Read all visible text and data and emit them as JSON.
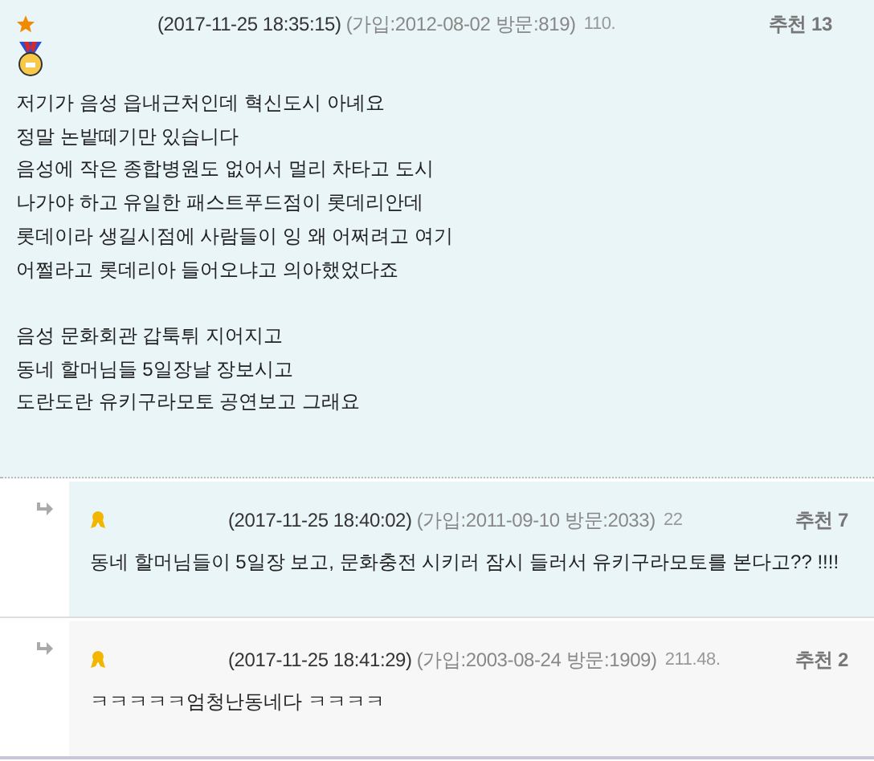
{
  "comments": [
    {
      "kind": "post",
      "date": "(2017-11-25 18:35:15)",
      "member_info": "(가입:2012-08-02 방문:819)",
      "ip": "110.",
      "likes_label": "추천",
      "likes": "13",
      "paragraphs": [
        [
          "저기가 음성 읍내근처인데 혁신도시 아녜요",
          "정말 논밭떼기만 있습니다",
          "음성에 작은 종합병원도 없어서 멀리 차타고 도시",
          "나가야 하고 유일한 패스트푸드점이 롯데리안데",
          "롯데이라 생길시점에 사람들이 잉 왜 어쩌려고 여기",
          "어쩔라고 롯데리아 들어오냐고 의아했었다죠"
        ],
        [
          "음성 문화회관 갑툭튀 지어지고",
          "동네 할머님들 5일장날 장보시고",
          "도란도란 유키구라모토 공연보고 그래요"
        ]
      ]
    },
    {
      "kind": "reply",
      "date": "(2017-11-25 18:40:02)",
      "member_info": "(가입:2011-09-10 방문:2033)",
      "ip": "22",
      "likes_label": "추천",
      "likes": "7",
      "paragraphs": [
        [
          "동네 할머님들이 5일장 보고, 문화충전 시키러 잠시 들러서 유키구라모토를 본다고?? !!!!"
        ]
      ]
    },
    {
      "kind": "reply",
      "date": "(2017-11-25 18:41:29)",
      "member_info": "(가입:2003-08-24 방문:1909)",
      "ip": "211.48.",
      "likes_label": "추천",
      "likes": "2",
      "paragraphs": [
        [
          "ㅋㅋㅋㅋㅋ엄청난동네다 ㅋㅋㅋㅋ"
        ]
      ]
    }
  ]
}
